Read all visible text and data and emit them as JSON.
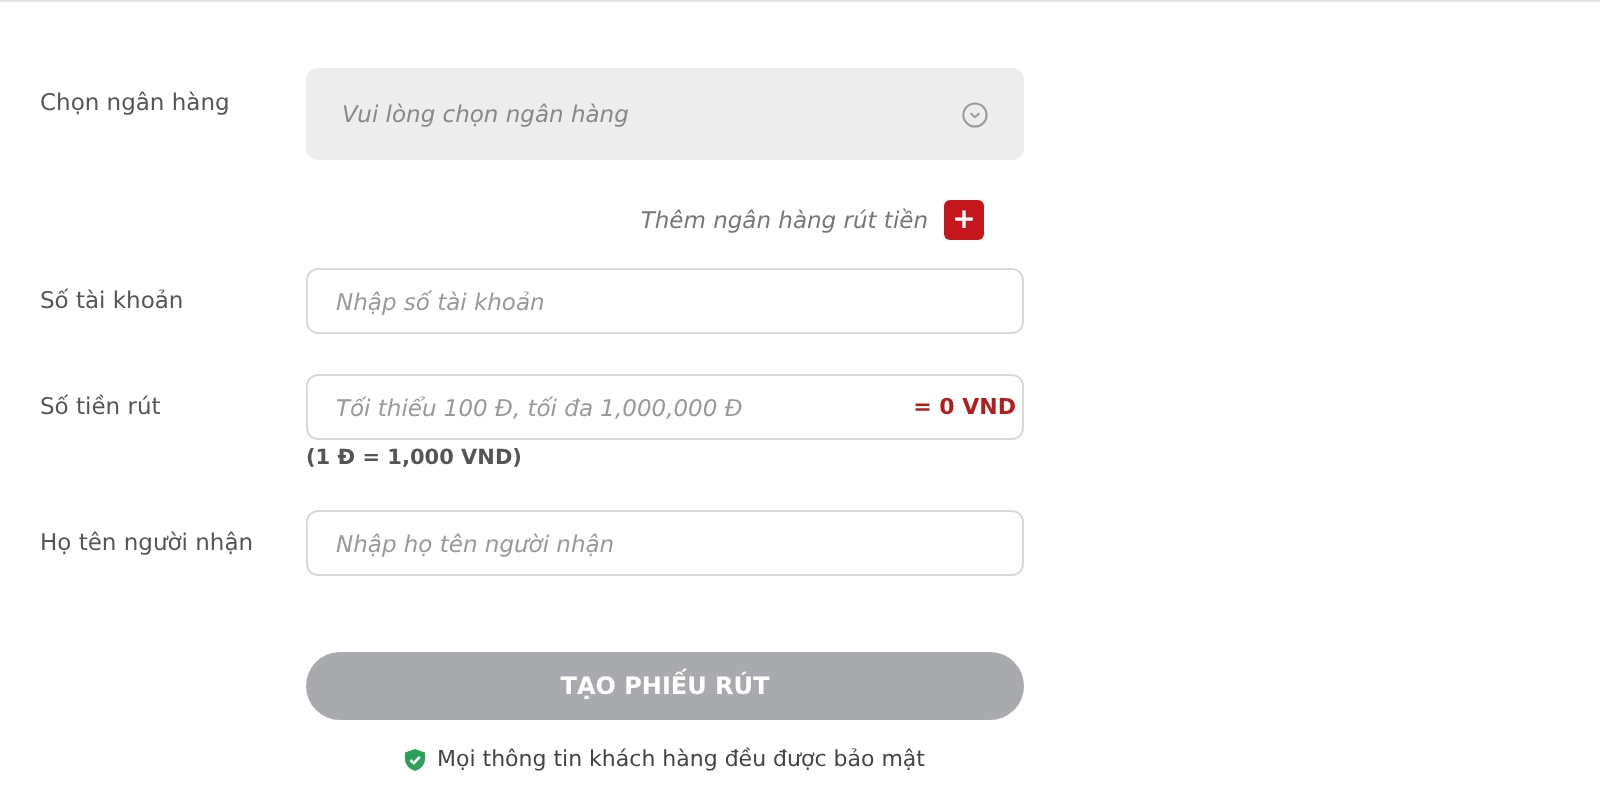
{
  "fields": [
    {
      "kind": "select",
      "label": "Chọn ngân hàng",
      "placeholder": "Vui lòng chọn ngân hàng"
    },
    {
      "kind": "text",
      "label": "Số tài khoản",
      "placeholder": "Nhập số tài khoản"
    },
    {
      "kind": "amount",
      "label": "Số tiền rút",
      "placeholder": "Tối thiểu 100 Đ, tối đa 1,000,000 Đ",
      "converted": "= 0 VND",
      "note": "(1 Đ = 1,000 VND)"
    },
    {
      "kind": "text",
      "label": "Họ tên người nhận",
      "placeholder": "Nhập họ tên người nhận"
    }
  ],
  "add_bank": {
    "label": "Thêm ngân hàng rút tiền",
    "button": "+"
  },
  "submit": {
    "label": "TẠO PHIẾU RÚT",
    "disabled": true
  },
  "security_note": "Mọi thông tin khách hàng đều được bảo mật"
}
